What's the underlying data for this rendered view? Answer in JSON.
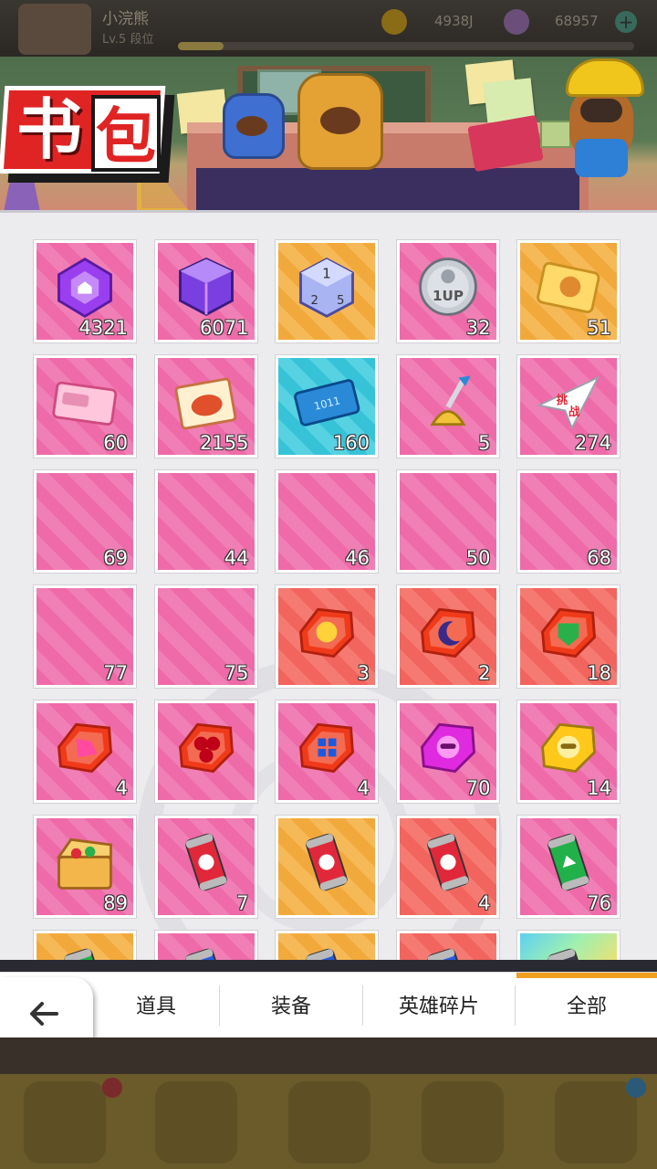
{
  "topbar": {
    "player_name": "小浣熊",
    "player_level": "Lv.5 段位",
    "coins": "4938J",
    "gems": "68957"
  },
  "header": {
    "title_char1": "书",
    "title_char2": "包"
  },
  "items": [
    {
      "row": 0,
      "col": 0,
      "bg": "pink",
      "icon": "purple-house-emblem-icon",
      "count": "4321"
    },
    {
      "row": 0,
      "col": 1,
      "bg": "pink",
      "icon": "purple-cube-icon",
      "count": "6071"
    },
    {
      "row": 0,
      "col": 2,
      "bg": "gold",
      "icon": "dice-icon",
      "count": ""
    },
    {
      "row": 0,
      "col": 3,
      "bg": "pink",
      "icon": "1up-coin-icon",
      "count": "32"
    },
    {
      "row": 0,
      "col": 4,
      "bg": "gold",
      "icon": "gold-card-icon",
      "count": "51"
    },
    {
      "row": 1,
      "col": 0,
      "bg": "pink",
      "icon": "pink-ticket-icon",
      "count": "60"
    },
    {
      "row": 1,
      "col": 1,
      "bg": "pink",
      "icon": "crab-photo-card-icon",
      "count": "2155"
    },
    {
      "row": 1,
      "col": 2,
      "bg": "blue",
      "icon": "binary-ticket-icon",
      "count": "160"
    },
    {
      "row": 1,
      "col": 3,
      "bg": "pink",
      "icon": "golden-bell-icon",
      "count": "5"
    },
    {
      "row": 1,
      "col": 4,
      "bg": "pink",
      "icon": "paper-plane-challenge-icon",
      "count": "274"
    },
    {
      "row": 2,
      "col": 0,
      "bg": "pink",
      "icon": "puzzle-piece-icon",
      "count": "69"
    },
    {
      "row": 2,
      "col": 1,
      "bg": "pink",
      "icon": "puzzle-piece-icon",
      "count": "44"
    },
    {
      "row": 2,
      "col": 2,
      "bg": "pink",
      "icon": "puzzle-piece-icon",
      "count": "46"
    },
    {
      "row": 2,
      "col": 3,
      "bg": "pink",
      "icon": "puzzle-piece-icon",
      "count": "50"
    },
    {
      "row": 2,
      "col": 4,
      "bg": "pink",
      "icon": "puzzle-piece-icon",
      "count": "68"
    },
    {
      "row": 3,
      "col": 0,
      "bg": "pink",
      "icon": "puzzle-piece-icon",
      "count": "77"
    },
    {
      "row": 3,
      "col": 1,
      "bg": "pink",
      "icon": "puzzle-piece-icon",
      "count": "75"
    },
    {
      "row": 3,
      "col": 2,
      "bg": "red",
      "icon": "sun-chip-icon",
      "count": "3"
    },
    {
      "row": 3,
      "col": 3,
      "bg": "red",
      "icon": "moon-chip-icon",
      "count": "2"
    },
    {
      "row": 3,
      "col": 4,
      "bg": "red",
      "icon": "green-leaf-chip-icon",
      "count": "18"
    },
    {
      "row": 4,
      "col": 0,
      "bg": "pink",
      "icon": "pink-shape-chip-icon",
      "count": "4"
    },
    {
      "row": 4,
      "col": 1,
      "bg": "pink",
      "icon": "red-circles-chip-icon",
      "count": ""
    },
    {
      "row": 4,
      "col": 2,
      "bg": "pink",
      "icon": "blue-squares-chip-icon",
      "count": "4"
    },
    {
      "row": 4,
      "col": 3,
      "bg": "pink",
      "icon": "raccoon-magenta-chip-icon",
      "count": "70"
    },
    {
      "row": 4,
      "col": 4,
      "bg": "pink",
      "icon": "raccoon-gold-chip-icon",
      "count": "14"
    },
    {
      "row": 5,
      "col": 0,
      "bg": "pink",
      "icon": "treasure-chest-icon",
      "count": "89"
    },
    {
      "row": 5,
      "col": 1,
      "bg": "pink",
      "icon": "red-fist-can-icon",
      "count": "7"
    },
    {
      "row": 5,
      "col": 2,
      "bg": "gold",
      "icon": "red-fist-can-icon",
      "count": ""
    },
    {
      "row": 5,
      "col": 3,
      "bg": "red",
      "icon": "red-fist-can-icon",
      "count": "4"
    },
    {
      "row": 5,
      "col": 4,
      "bg": "pink",
      "icon": "green-wing-can-icon",
      "count": "76"
    },
    {
      "row": 6,
      "col": 0,
      "bg": "gold",
      "icon": "green-can-icon",
      "count": ""
    },
    {
      "row": 6,
      "col": 1,
      "bg": "pink",
      "icon": "blue-can-icon",
      "count": ""
    },
    {
      "row": 6,
      "col": 2,
      "bg": "gold",
      "icon": "blue-can-icon",
      "count": ""
    },
    {
      "row": 6,
      "col": 3,
      "bg": "red",
      "icon": "blue-can-icon",
      "count": ""
    },
    {
      "row": 6,
      "col": 4,
      "bg": "rainbow",
      "icon": "dark-can-icon",
      "count": ""
    }
  ],
  "tabs": [
    {
      "label": "道具",
      "active": false
    },
    {
      "label": "装备",
      "active": false
    },
    {
      "label": "英雄碎片",
      "active": false
    },
    {
      "label": "全部",
      "active": true
    }
  ],
  "back_button": {
    "icon": "arrow-left-icon",
    "label": "返回"
  },
  "colors": {
    "tab_active": "#f0a020",
    "title_red": "#e02424",
    "pink_bg": "#ee6aa8",
    "gold_bg": "#f2a93c",
    "red_bg": "#f2645e",
    "blue_bg": "#36c3d8"
  }
}
